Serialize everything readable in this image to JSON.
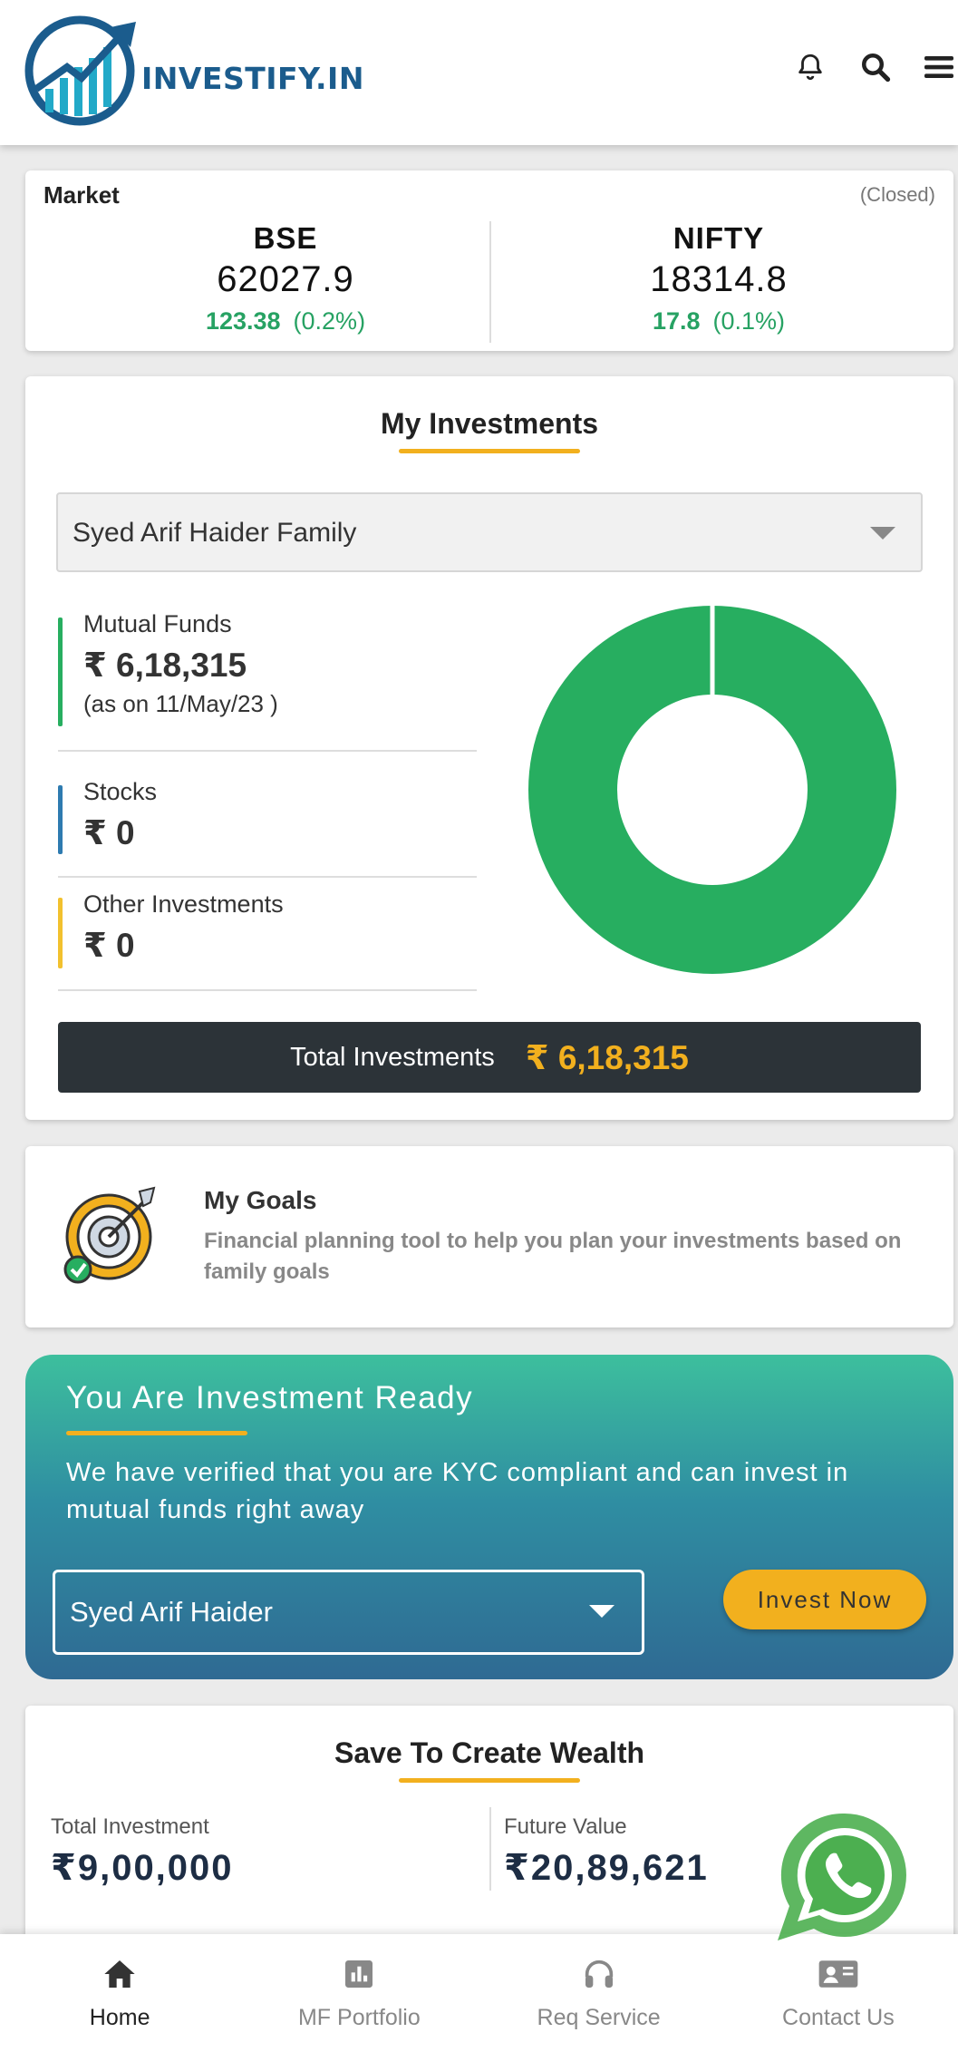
{
  "header": {
    "logo_text": "INVESTIFY.IN",
    "icons": [
      "bell-icon",
      "search-icon",
      "menu-icon"
    ]
  },
  "market": {
    "label": "Market",
    "status": "(Closed)",
    "indices": [
      {
        "name": "BSE",
        "value": "62027.9",
        "change": "123.38",
        "percent": "(0.2%)"
      },
      {
        "name": "NIFTY",
        "value": "18314.8",
        "change": "17.8",
        "percent": "(0.1%)"
      }
    ]
  },
  "investments": {
    "title": "My Investments",
    "selected_family": "Syed Arif Haider Family",
    "items": [
      {
        "label": "Mutual Funds",
        "amount": "₹ 6,18,315",
        "note": "(as on 11/May/23 )",
        "color": "#27ae60"
      },
      {
        "label": "Stocks",
        "amount": "₹ 0",
        "color": "#2e7bb0"
      },
      {
        "label": "Other Investments",
        "amount": "₹ 0",
        "color": "#f2c12e"
      }
    ],
    "total_label": "Total Investments",
    "total_amount": "₹ 6,18,315"
  },
  "chart_data": {
    "type": "pie",
    "categories": [
      "Mutual Funds",
      "Stocks",
      "Other Investments"
    ],
    "values": [
      618315,
      0,
      0
    ],
    "colors": [
      "#27ae60",
      "#2e7bb0",
      "#f2c12e"
    ]
  },
  "goals": {
    "title": "My Goals",
    "description": "Financial planning tool to help you plan your investments based on family goals"
  },
  "ready": {
    "title": "You Are Investment Ready",
    "description": "We have verified that you are KYC compliant and can invest in mutual funds right away",
    "selected_person": "Syed Arif Haider",
    "button_label": "Invest Now"
  },
  "wealth": {
    "title": "Save To Create Wealth",
    "total_investment_label": "Total Investment",
    "total_investment_value": "₹9,00,000",
    "future_value_label": "Future Value",
    "future_value_value": "₹20,89,621"
  },
  "nav": {
    "items": [
      {
        "label": "Home",
        "icon": "home-icon",
        "active": true
      },
      {
        "label": "MF Portfolio",
        "icon": "portfolio-icon",
        "active": false
      },
      {
        "label": "Req Service",
        "icon": "headset-icon",
        "active": false
      },
      {
        "label": "Contact Us",
        "icon": "contact-icon",
        "active": false
      }
    ]
  }
}
